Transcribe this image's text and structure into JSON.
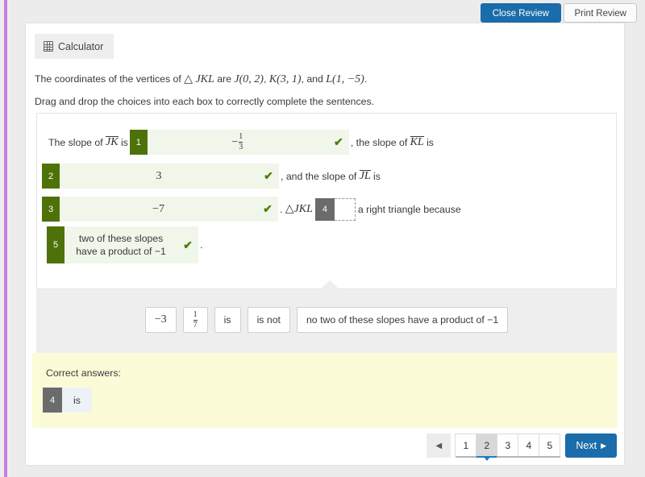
{
  "topbar": {
    "close_review": "Close Review",
    "print_review": "Print Review"
  },
  "toolbar": {
    "calculator_label": "Calculator",
    "calculator_icon": "calculator-icon"
  },
  "question": {
    "statement_prefix": "The coordinates of the vertices of",
    "triangle_symbol": "△",
    "triangle_name": "JKL",
    "statement_are": "are",
    "point_j": "J(0, 2)",
    "point_k": "K(3, 1)",
    "statement_and": ", and",
    "point_l": "L(1,  −5)",
    "statement_end": ".",
    "instruction": "Drag and drop the choices into each box to correctly complete the sentences."
  },
  "sentence": {
    "text_slope_of": "The slope of",
    "seg_jk": "JK",
    "text_is": "is",
    "text_the_slope_of": ", the slope of",
    "seg_kl": "KL",
    "text_and_slope_of": ", and the slope of",
    "seg_jl": "JL",
    "text_is2": "is",
    "text_triangle": "JKL",
    "text_right_triangle": "a right triangle because",
    "text_period": "."
  },
  "answers": [
    {
      "tag": "1",
      "value_num": "−1",
      "value_den": "3",
      "is_fraction": true,
      "correct": true
    },
    {
      "tag": "2",
      "value": "3",
      "is_fraction": false,
      "correct": true
    },
    {
      "tag": "3",
      "value": "−7",
      "is_fraction": false,
      "correct": true
    },
    {
      "tag": "4",
      "value": "",
      "is_fraction": false,
      "correct": false
    },
    {
      "tag": "5",
      "value": "two of these slopes have a product of −1",
      "is_fraction": false,
      "correct": true
    }
  ],
  "check_glyph": "✔",
  "tray": {
    "choices": [
      {
        "label": "−3",
        "type": "math"
      },
      {
        "label": "1/7",
        "num": "1",
        "den": "7",
        "type": "fraction"
      },
      {
        "label": "is",
        "type": "text"
      },
      {
        "label": "is not",
        "type": "text"
      },
      {
        "label": "no two of these slopes have a product of −1",
        "type": "text"
      }
    ]
  },
  "correct_answers": {
    "heading": "Correct answers:",
    "tag": "4",
    "value": "is"
  },
  "pagination": {
    "prev_glyph": "◀",
    "pages": [
      "1",
      "2",
      "3",
      "4",
      "5"
    ],
    "active_page": "2",
    "next_label": "Next",
    "next_glyph": "▶"
  },
  "colors": {
    "accent_blue": "#1a6cab",
    "correct_green": "#4e7209",
    "slot_gray": "#6b6b6b",
    "highlight_yellow": "#fbfbd7",
    "stripe_purple": "#c77ee0"
  }
}
